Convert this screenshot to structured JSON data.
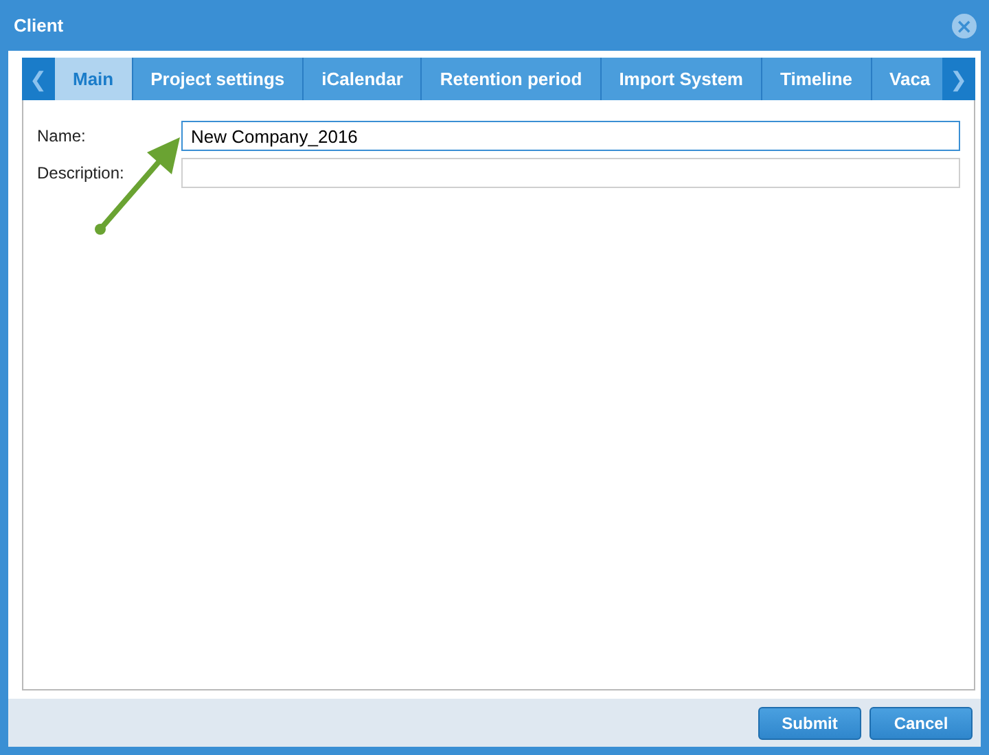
{
  "window": {
    "title": "Client",
    "close": "⨯"
  },
  "tabs": {
    "prev": "❮",
    "next": "❯",
    "items": [
      {
        "label": "Main",
        "selected": true
      },
      {
        "label": "Project settings",
        "selected": false
      },
      {
        "label": "iCalendar",
        "selected": false
      },
      {
        "label": "Retention period",
        "selected": false
      },
      {
        "label": "Import System",
        "selected": false
      },
      {
        "label": "Timeline",
        "selected": false
      },
      {
        "label": "Vaca",
        "selected": false
      }
    ]
  },
  "form": [
    {
      "label": "Name:",
      "value": "New Company_2016",
      "focused": true
    },
    {
      "label": "Description:",
      "focused": false
    }
  ],
  "buttons": [
    "Submit",
    "Cancel"
  ]
}
